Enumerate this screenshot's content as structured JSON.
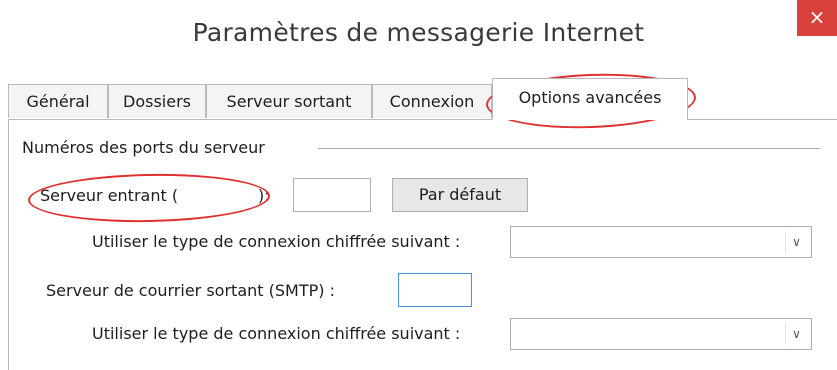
{
  "window": {
    "title": "Paramètres de messagerie Internet",
    "close_glyph": "×",
    "close_color": "#d9423b"
  },
  "tabs": [
    {
      "label": "Général"
    },
    {
      "label": "Dossiers"
    },
    {
      "label": "Serveur sortant"
    },
    {
      "label": "Connexion"
    },
    {
      "label": "Options avancées",
      "active": true
    }
  ],
  "server_ports": {
    "group_label": "Numéros des ports du serveur",
    "incoming_label": "Serveur entrant (",
    "incoming_label_end": "):",
    "incoming_value": "",
    "default_button": "Par défaut",
    "incoming_encryption_label": "Utiliser le type de connexion chiffrée suivant :",
    "incoming_encryption_value": "",
    "outgoing_label": "Serveur de courrier sortant (SMTP) :",
    "outgoing_value": "",
    "outgoing_encryption_label": "Utiliser le type de connexion chiffrée suivant :",
    "outgoing_encryption_value": ""
  },
  "icons": {
    "close": "close-icon",
    "dropdown": "chevron-down-icon"
  },
  "annotation_color": "#e03030"
}
